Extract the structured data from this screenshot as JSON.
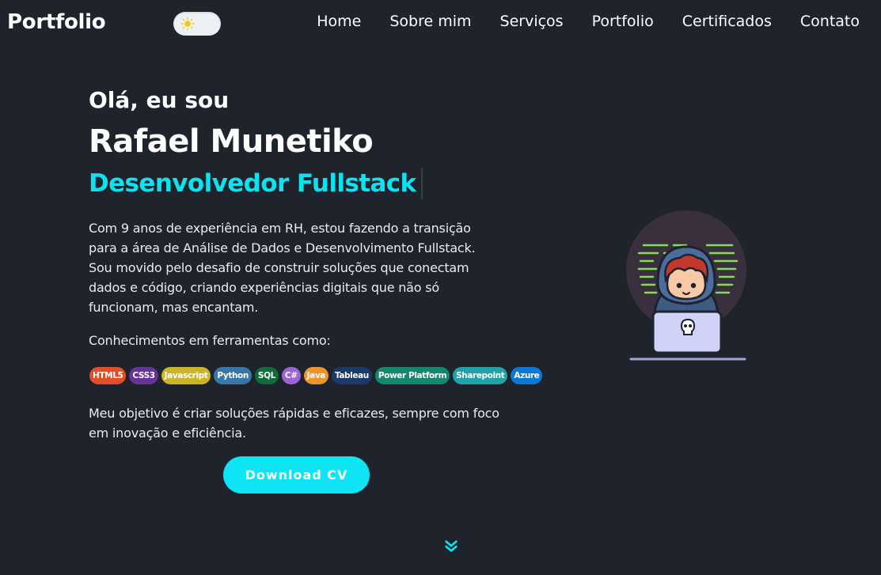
{
  "header": {
    "brand": "Portfolio",
    "theme_toggle_icon": "sun-icon",
    "nav": [
      "Home",
      "Sobre mim",
      "Serviços",
      "Portfolio",
      "Certificados",
      "Contato"
    ]
  },
  "hero": {
    "greeting": "Olá, eu sou",
    "name": "Rafael Munetiko",
    "role": "Desenvolvedor Fullstack",
    "intro": "Com 9 anos de experiência em RH, estou fazendo a transição para a área de Análise de Dados e Desenvolvimento Fullstack. Sou movido pelo desafio de construir soluções que conectam dados e código, criando experiências digitais que não só funcionam, mas encantam.",
    "skills_label": "Conhecimentos em ferramentas como:",
    "skills": [
      {
        "label": "HTML5",
        "color": "#e44d26"
      },
      {
        "label": "CSS3",
        "color": "#663399"
      },
      {
        "label": "Javascript",
        "color": "#c9b527"
      },
      {
        "label": "Python",
        "color": "#3776ab"
      },
      {
        "label": "SQL",
        "color": "#0f6b3a"
      },
      {
        "label": "C#",
        "color": "#9b63d6"
      },
      {
        "label": "Java",
        "color": "#f0932b"
      },
      {
        "label": "Tableau",
        "color": "#1b3a6b"
      },
      {
        "label": "Power Platform",
        "color": "#14876f"
      },
      {
        "label": "Sharepoint",
        "color": "#1fa3a8"
      },
      {
        "label": "Azure",
        "color": "#0a78d4"
      }
    ],
    "goal": "Meu objetivo é criar soluções rápidas e eficazes, sempre com foco em inovação e eficiência.",
    "cv_button": "Download CV",
    "scroll_icon": "double-chevron-down-icon",
    "illustration_icon": "hacker-laptop-illustration"
  },
  "colors": {
    "background": "#1f232b",
    "accent": "#0ce3f1",
    "text": "#ffffff"
  }
}
